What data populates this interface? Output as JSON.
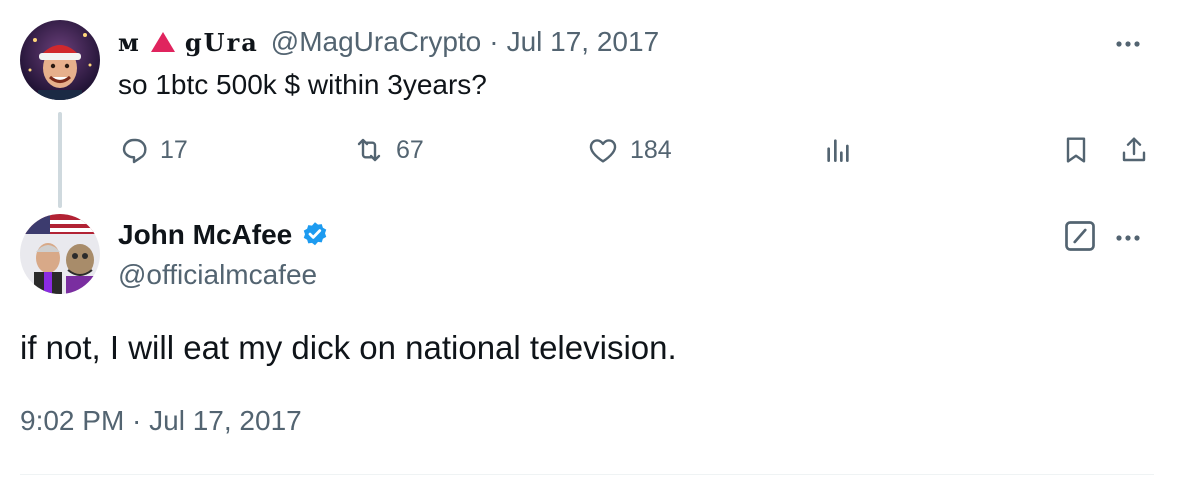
{
  "reply_tweet": {
    "display_name": {
      "part1": "ᴍ",
      "part2": "gUra"
    },
    "handle": "@MagUraCrypto",
    "separator": "·",
    "date": "Jul 17, 2017",
    "text": "so 1btc 500k $ within 3years?",
    "actions": {
      "replies": "17",
      "retweets": "67",
      "likes": "184"
    }
  },
  "main_tweet": {
    "display_name": "John McAfee",
    "handle": "@officialmcafee",
    "text": "if not, I will eat my dick on national television.",
    "timestamp": "9:02 PM · Jul 17, 2017"
  },
  "colors": {
    "text": "#0f1419",
    "muted": "#536471",
    "verified": "#1d9bf0",
    "thread_line": "#cfd9de",
    "triangle": "#e0245e"
  },
  "icons": [
    "reply-icon",
    "retweet-icon",
    "like-icon",
    "views-icon",
    "bookmark-icon",
    "share-icon",
    "more-icon",
    "grok-icon",
    "verified-badge-icon"
  ]
}
